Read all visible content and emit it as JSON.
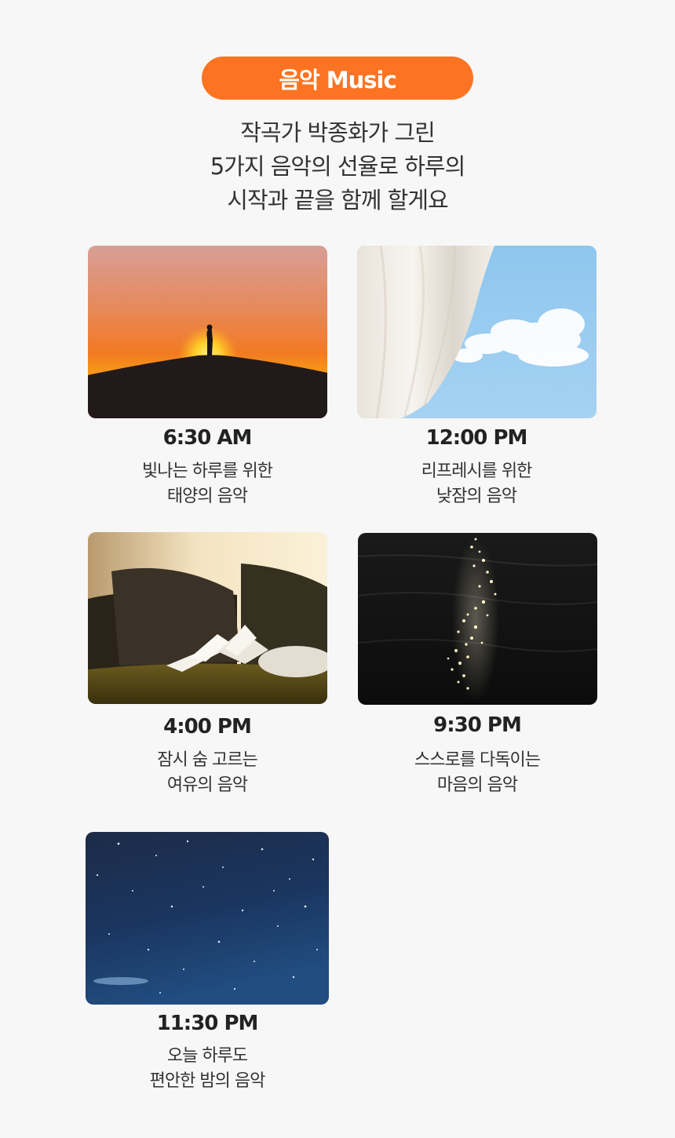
{
  "badge": {
    "label": "음악 Music"
  },
  "intro": {
    "lines": [
      "작곡가 박종화가 그린",
      "5가지 음악의 선율로 하루의",
      "시작과 끝을 함께 할게요"
    ]
  },
  "cards": [
    {
      "time": "6:30 AM",
      "desc": [
        "빛나는 하루를 위한",
        "태양의 음악"
      ],
      "image": "sunrise-silhouette-photo"
    },
    {
      "time": "12:00 PM",
      "desc": [
        "리프레시를 위한",
        "낮잠의 음악"
      ],
      "image": "curtain-sky-photo"
    },
    {
      "time": "4:00 PM",
      "desc": [
        "잠시 숨 고르는",
        "여유의 음악"
      ],
      "image": "sofa-book-photo"
    },
    {
      "time": "9:30 PM",
      "desc": [
        "스스로를 다독이는",
        "마음의 음악"
      ],
      "image": "night-sea-photo"
    },
    {
      "time": "11:30 PM",
      "desc": [
        "오늘 하루도",
        "편안한 밤의 음악"
      ],
      "image": "starry-sky-photo"
    }
  ],
  "colors": {
    "accent": "#fc7423",
    "background": "#f7f7f7",
    "text": "#333333"
  }
}
